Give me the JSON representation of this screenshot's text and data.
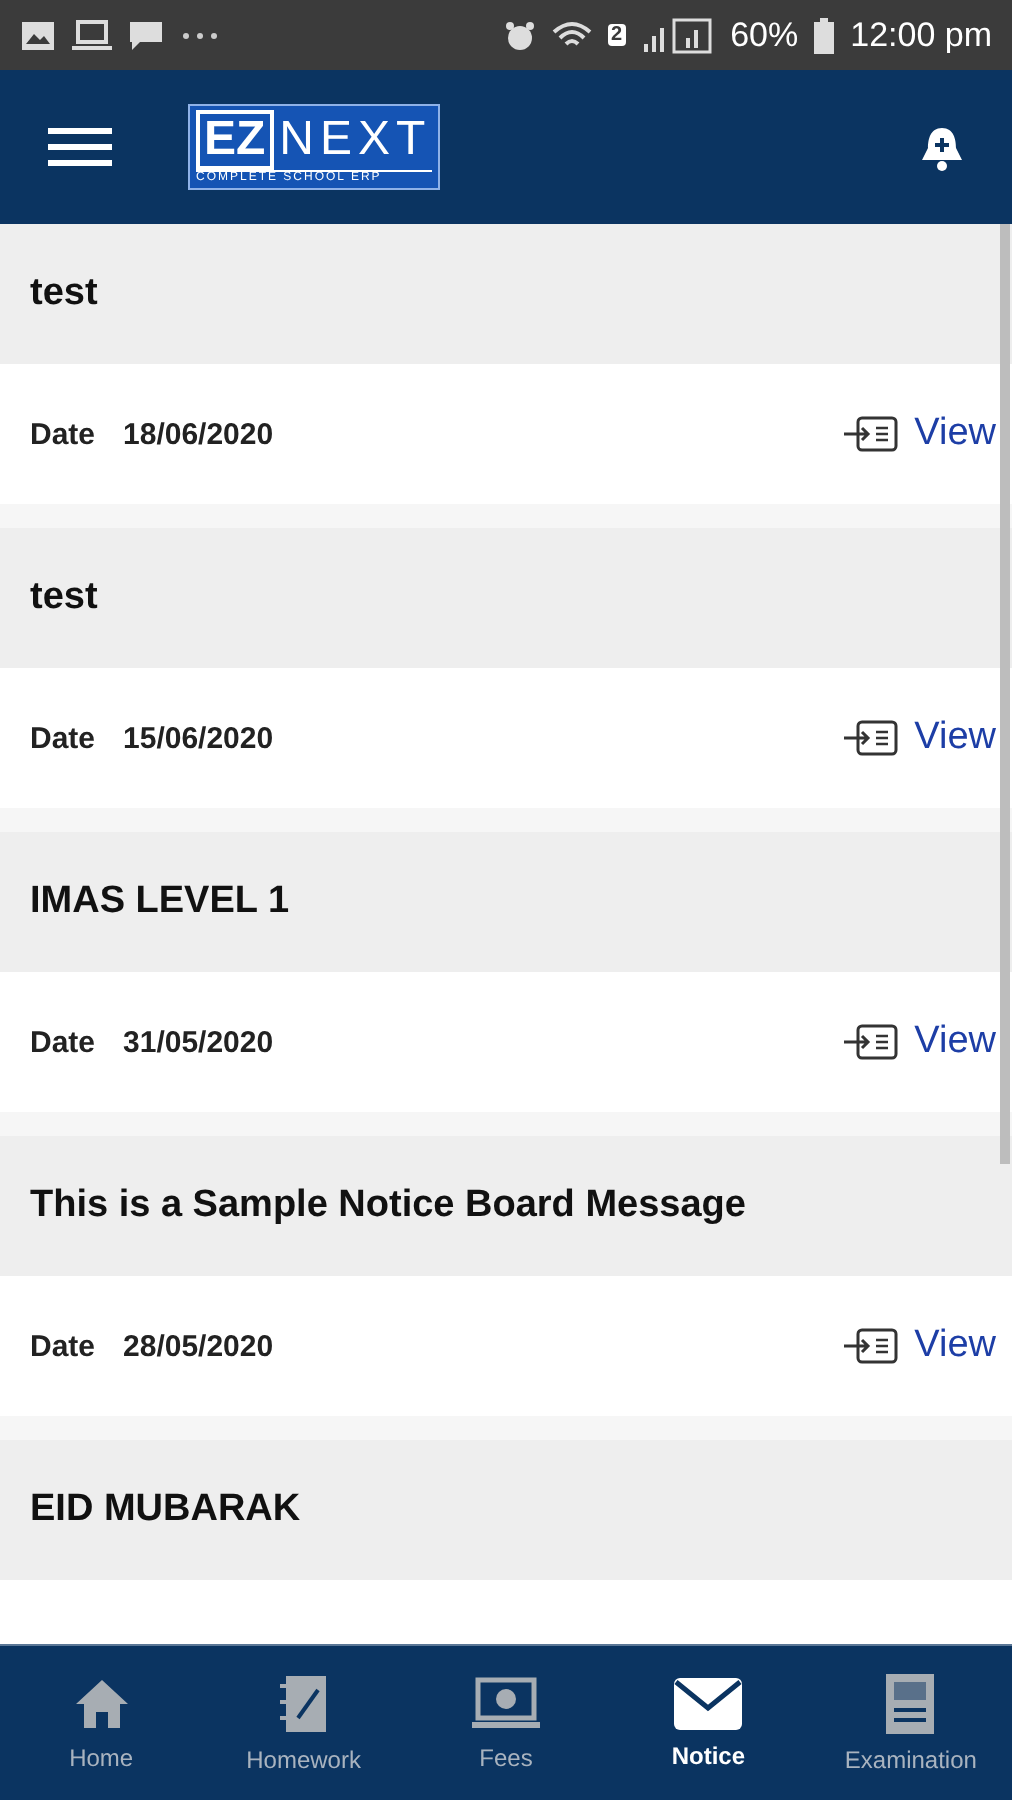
{
  "status_bar": {
    "sim_badge": "2",
    "battery": "60%",
    "time": "12:00 pm"
  },
  "header": {
    "logo": {
      "left": "EZ",
      "right": "NEXT",
      "tagline": "COMPLETE SCHOOL ERP"
    }
  },
  "notices": [
    {
      "title": "test",
      "date_label": "Date",
      "date": "18/06/2020",
      "action": "View"
    },
    {
      "title": "test",
      "date_label": "Date",
      "date": "15/06/2020",
      "action": "View"
    },
    {
      "title": "IMAS LEVEL 1",
      "date_label": "Date",
      "date": "31/05/2020",
      "action": "View"
    },
    {
      "title": "This is a Sample Notice Board Message",
      "date_label": "Date",
      "date": "28/05/2020",
      "action": "View"
    },
    {
      "title": "EID MUBARAK"
    }
  ],
  "bottom_nav": [
    {
      "label": "Home",
      "selected": false
    },
    {
      "label": "Homework",
      "selected": false
    },
    {
      "label": "Fees",
      "selected": false
    },
    {
      "label": "Notice",
      "selected": true
    },
    {
      "label": "Examination",
      "selected": false
    }
  ]
}
